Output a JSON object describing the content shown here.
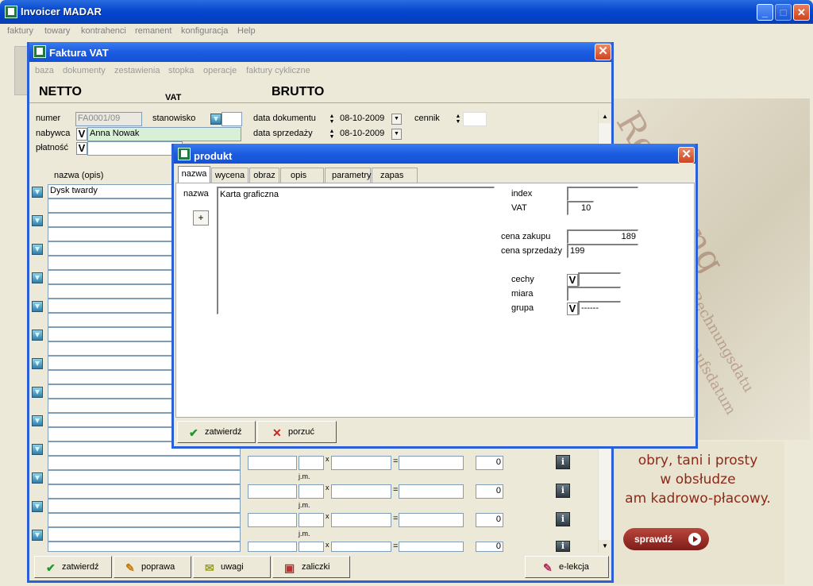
{
  "app": {
    "title": "Invoicer MADAR"
  },
  "menu": [
    "faktury",
    "towary",
    "kontrahenci",
    "remanent",
    "konfiguracja",
    "Help"
  ],
  "promo": {
    "lines": [
      "obry, tani i prosty",
      "w obsłudze",
      "am kadrowo-płacowy."
    ],
    "button": "sprawdź",
    "bgwords": [
      "Rechnung",
      "Rechnungsdatu",
      "Verkaufsdatum"
    ]
  },
  "invoice": {
    "title": "Faktura VAT",
    "menu": [
      "baza",
      "dokumenty",
      "zestawienia",
      "stopka",
      "operacje",
      "faktury cykliczne"
    ],
    "netto": "NETTO",
    "vat": "VAT",
    "brutto": "BRUTTO",
    "numer_label": "numer",
    "numer_value": "FA0001/09",
    "stanowisko_label": "stanowisko",
    "data_dok_label": "data dokumentu",
    "data_dok_value": "08-10-2009",
    "cennik_label": "cennik",
    "nabywca_label": "nabywca",
    "nabywca_value": "Anna Nowak",
    "data_sprz_label": "data sprzedaży",
    "data_sprz_value": "08-10-2009",
    "platnosc_label": "płatność",
    "nazwa_header": "nazwa  (opis)",
    "first_item": "Dysk twardy",
    "jm_label": "j.m.",
    "times": "x",
    "equals": "=",
    "qty_zero": "0",
    "info": "i",
    "buttons": {
      "zatwierdz": "zatwierdź",
      "poprawa": "poprawa",
      "uwagi": "uwagi",
      "zaliczki": "zaliczki",
      "elekcja": "e-lekcja"
    }
  },
  "produkt": {
    "title": "produkt",
    "tabs": [
      "nazwa",
      "wycena",
      "obraz",
      "opis",
      "parametry",
      "zapas"
    ],
    "nazwa_label": "nazwa",
    "plus": "+",
    "nazwa_value": "Karta graficzna",
    "index_label": "index",
    "index_value": "",
    "vat_label": "VAT",
    "vat_value": "10",
    "cena_zakupu_label": "cena zakupu",
    "cena_zakupu_value": "189",
    "cena_sprzedazy_label": "cena sprzedaży",
    "cena_sprzedazy_value": "199",
    "cechy_label": "cechy",
    "miara_label": "miara",
    "grupa_label": "grupa",
    "grupa_value": "------",
    "v_mark": "V",
    "zatwierdz": "zatwierdź",
    "porzuc": "porzuć"
  }
}
